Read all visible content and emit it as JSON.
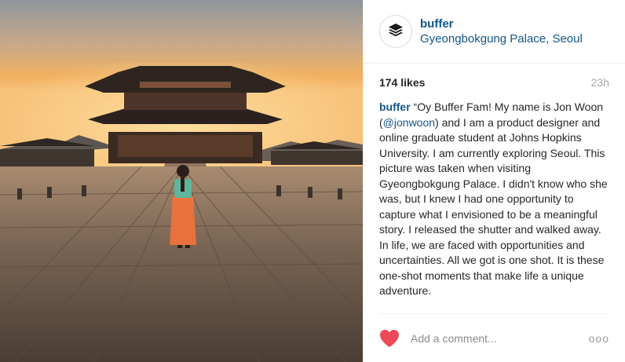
{
  "post": {
    "username": "buffer",
    "location": "Gyeongbokgung Palace, Seoul",
    "likes": "174 likes",
    "time": "23h",
    "caption": {
      "user": "buffer",
      "text_before": " “Oy Buffer Fam! My name is Jon Woon (",
      "mention": "@jonwoon",
      "text_after": ") and I am a product designer and online graduate student at Johns Hopkins University. I am currently exploring Seoul. This picture was taken when visiting Gyeongbokgung Palace. I didn't know who she was, but I knew I had one opportunity to capture what I envisioned to be a meaningful story. I released the shutter and walked away.",
      "paragraph2": "In life, we are faced with opportunities and uncertainties. All we got is one shot. It is these one-shot moments that make life a unique adventure."
    },
    "comment_placeholder": "Add a comment...",
    "more_label": "ooo"
  },
  "colors": {
    "link": "#125688",
    "heart": "#ed4956",
    "muted": "#a5a7aa"
  },
  "icons": {
    "avatar": "buffer-logo-icon",
    "like": "heart-icon",
    "more": "more-options-icon"
  }
}
